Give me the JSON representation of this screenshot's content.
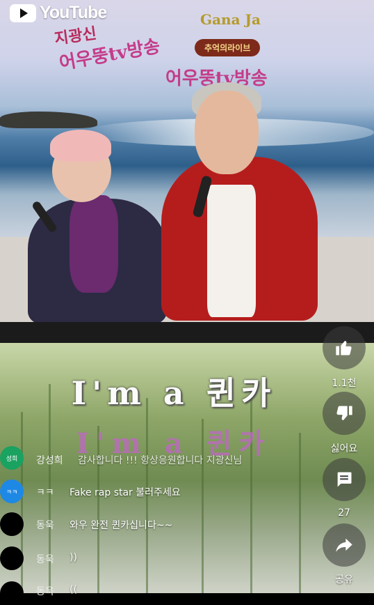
{
  "brand": {
    "logo_text": "YouTube",
    "logo_icon": "youtube-play-icon"
  },
  "banner": {
    "line1": "지광신",
    "line2": "어우뚱tv방송",
    "line3": "어우뚱tv방송",
    "line4": "Gana Ja",
    "badge": "추억의라이브"
  },
  "lyrics": {
    "main": "I'm a 퀸카",
    "ghost": "I'm a 퀸카"
  },
  "chat": [
    {
      "avatar_text": "성희",
      "avatar_color": "#1aa260",
      "name": "강성희",
      "message": "감사합니다 !!! 항상응원합니다 지광신님"
    },
    {
      "avatar_text": "ㅋㅋ",
      "avatar_color": "#1e88e5",
      "name": "ㅋㅋ",
      "message": "Fake rap star 불러주세요"
    },
    {
      "avatar_text": "",
      "avatar_color": "#000000",
      "name": "동욱",
      "message": "와우 완전 퀸카십니다~~"
    },
    {
      "avatar_text": "",
      "avatar_color": "#000000",
      "name": "동욱",
      "message": "))"
    },
    {
      "avatar_text": "",
      "avatar_color": "#000000",
      "name": "동욱",
      "message": "(("
    }
  ],
  "actions": {
    "like": {
      "icon": "thumbs-up-icon",
      "label": "1.1천"
    },
    "dislike": {
      "icon": "thumbs-down-icon",
      "label": "싫어요"
    },
    "comments": {
      "icon": "comment-icon",
      "label": "27"
    },
    "share": {
      "icon": "share-icon",
      "label": "공유"
    }
  }
}
